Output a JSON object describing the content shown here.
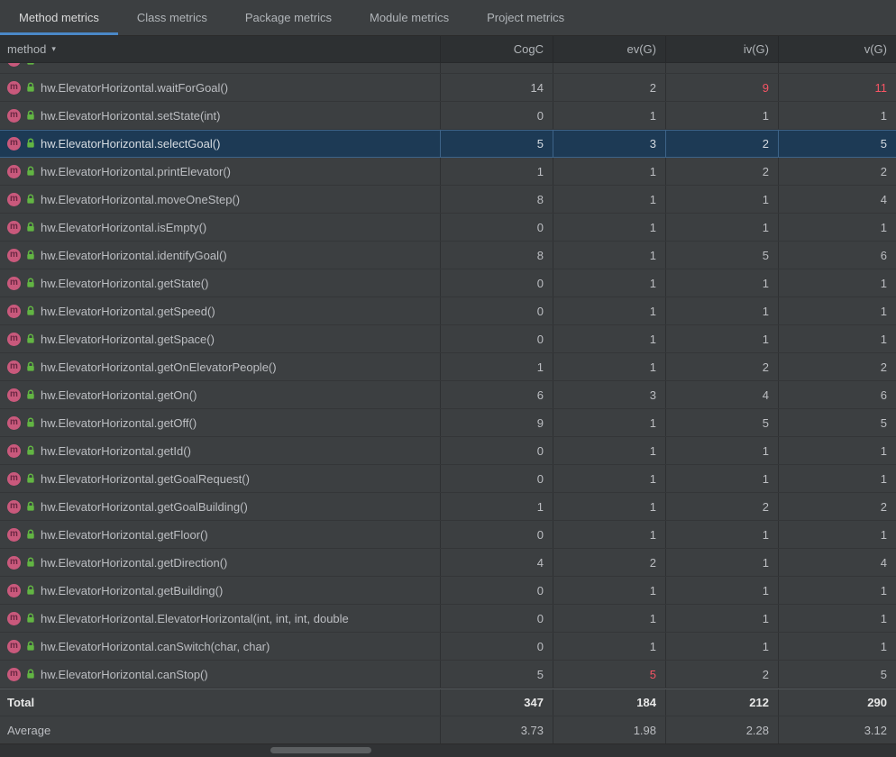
{
  "tabs": [
    {
      "label": "Method metrics"
    },
    {
      "label": "Class metrics"
    },
    {
      "label": "Package metrics"
    },
    {
      "label": "Module metrics"
    },
    {
      "label": "Project metrics"
    }
  ],
  "active_tab": 0,
  "icons": {
    "method": "m",
    "visibility": "public-lock"
  },
  "colors": {
    "accent": "#4a88c7",
    "warning_red": "#f75464",
    "selection": "#1d3a55",
    "method_icon": "#c9597c",
    "visibility_green": "#62b543"
  },
  "table": {
    "sort_label": "method",
    "sort_icon": "▾",
    "columns": [
      "CogC",
      "ev(G)",
      "iv(G)",
      "v(G)"
    ],
    "selected_row": 2,
    "rows": [
      {
        "method": "hw.ElevatorHorizontal.waitForGoal()",
        "values": [
          "14",
          "2",
          "9",
          "11"
        ],
        "red": [
          2,
          3
        ]
      },
      {
        "method": "hw.ElevatorHorizontal.setState(int)",
        "values": [
          "0",
          "1",
          "1",
          "1"
        ]
      },
      {
        "method": "hw.ElevatorHorizontal.selectGoal()",
        "values": [
          "5",
          "3",
          "2",
          "5"
        ]
      },
      {
        "method": "hw.ElevatorHorizontal.printElevator()",
        "values": [
          "1",
          "1",
          "2",
          "2"
        ]
      },
      {
        "method": "hw.ElevatorHorizontal.moveOneStep()",
        "values": [
          "8",
          "1",
          "1",
          "4"
        ]
      },
      {
        "method": "hw.ElevatorHorizontal.isEmpty()",
        "values": [
          "0",
          "1",
          "1",
          "1"
        ]
      },
      {
        "method": "hw.ElevatorHorizontal.identifyGoal()",
        "values": [
          "8",
          "1",
          "5",
          "6"
        ]
      },
      {
        "method": "hw.ElevatorHorizontal.getState()",
        "values": [
          "0",
          "1",
          "1",
          "1"
        ]
      },
      {
        "method": "hw.ElevatorHorizontal.getSpeed()",
        "values": [
          "0",
          "1",
          "1",
          "1"
        ]
      },
      {
        "method": "hw.ElevatorHorizontal.getSpace()",
        "values": [
          "0",
          "1",
          "1",
          "1"
        ]
      },
      {
        "method": "hw.ElevatorHorizontal.getOnElevatorPeople()",
        "values": [
          "1",
          "1",
          "2",
          "2"
        ]
      },
      {
        "method": "hw.ElevatorHorizontal.getOn()",
        "values": [
          "6",
          "3",
          "4",
          "6"
        ]
      },
      {
        "method": "hw.ElevatorHorizontal.getOff()",
        "values": [
          "9",
          "1",
          "5",
          "5"
        ]
      },
      {
        "method": "hw.ElevatorHorizontal.getId()",
        "values": [
          "0",
          "1",
          "1",
          "1"
        ]
      },
      {
        "method": "hw.ElevatorHorizontal.getGoalRequest()",
        "values": [
          "0",
          "1",
          "1",
          "1"
        ]
      },
      {
        "method": "hw.ElevatorHorizontal.getGoalBuilding()",
        "values": [
          "1",
          "1",
          "2",
          "2"
        ]
      },
      {
        "method": "hw.ElevatorHorizontal.getFloor()",
        "values": [
          "0",
          "1",
          "1",
          "1"
        ]
      },
      {
        "method": "hw.ElevatorHorizontal.getDirection()",
        "values": [
          "4",
          "2",
          "1",
          "4"
        ]
      },
      {
        "method": "hw.ElevatorHorizontal.getBuilding()",
        "values": [
          "0",
          "1",
          "1",
          "1"
        ]
      },
      {
        "method": "hw.ElevatorHorizontal.ElevatorHorizontal(int, int, int, double",
        "values": [
          "0",
          "1",
          "1",
          "1"
        ]
      },
      {
        "method": "hw.ElevatorHorizontal.canSwitch(char, char)",
        "values": [
          "0",
          "1",
          "1",
          "1"
        ]
      },
      {
        "method": "hw.ElevatorHorizontal.canStop()",
        "values": [
          "5",
          "5",
          "2",
          "5"
        ],
        "red": [
          1
        ]
      }
    ],
    "total": {
      "label": "Total",
      "values": [
        "347",
        "184",
        "212",
        "290"
      ]
    },
    "average": {
      "label": "Average",
      "values": [
        "3.73",
        "1.98",
        "2.28",
        "3.12"
      ]
    }
  }
}
